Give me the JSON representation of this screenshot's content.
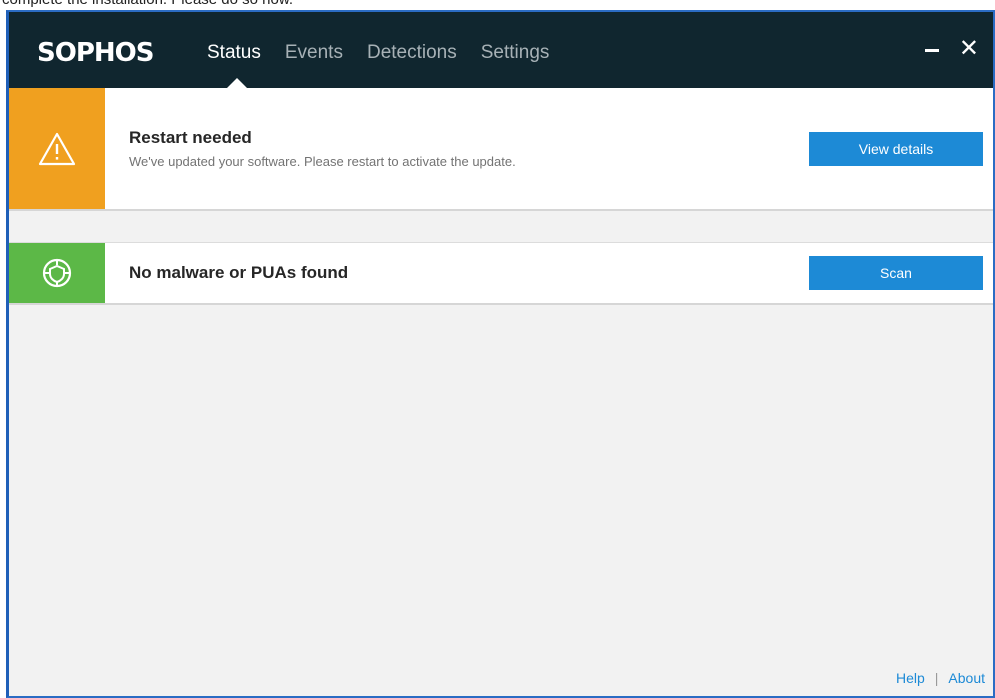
{
  "document": {
    "line_text": "complete the installation. Please do so now."
  },
  "titlebar": {
    "logo": "SOPHOS",
    "tabs": [
      {
        "label": "Status",
        "active": true
      },
      {
        "label": "Events",
        "active": false
      },
      {
        "label": "Detections",
        "active": false
      },
      {
        "label": "Settings",
        "active": false
      }
    ],
    "minimize_icon": "minimize-icon",
    "close_icon": "close-icon",
    "close_glyph": "✕"
  },
  "restart_card": {
    "icon": "warning-icon",
    "title": "Restart needed",
    "subtitle": "We've updated your software. Please restart to activate the update.",
    "button_label": "View details",
    "accent_color": "#f0a01f"
  },
  "malware_card": {
    "icon": "shield-icon",
    "title": "No malware or PUAs found",
    "button_label": "Scan",
    "accent_color": "#5cb847"
  },
  "footer": {
    "help_label": "Help",
    "separator": "|",
    "about_label": "About"
  },
  "colors": {
    "header_bg": "#10262f",
    "button_bg": "#1d8ad6",
    "link": "#1d8ad6",
    "window_border": "#2b6cc4"
  }
}
